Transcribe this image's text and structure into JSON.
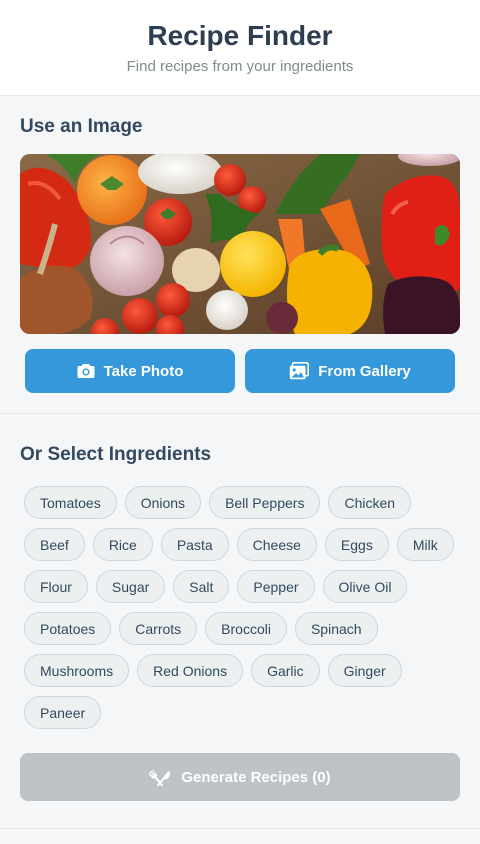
{
  "header": {
    "title": "Recipe Finder",
    "subtitle": "Find recipes from your ingredients"
  },
  "image_section": {
    "title": "Use an Image",
    "image_icon": "vegetables-photo",
    "take_photo_label": "Take Photo",
    "take_photo_icon": "camera-icon",
    "gallery_label": "From Gallery",
    "gallery_icon": "gallery-icon"
  },
  "ingredients_section": {
    "title": "Or Select Ingredients",
    "items": [
      "Tomatoes",
      "Onions",
      "Bell Peppers",
      "Chicken",
      "Beef",
      "Rice",
      "Pasta",
      "Cheese",
      "Eggs",
      "Milk",
      "Flour",
      "Sugar",
      "Salt",
      "Pepper",
      "Olive Oil",
      "Potatoes",
      "Carrots",
      "Broccoli",
      "Spinach",
      "Mushrooms",
      "Red Onions",
      "Garlic",
      "Ginger",
      "Paneer"
    ]
  },
  "generate": {
    "label": "Generate Recipes (0)",
    "icon": "utensils-icon",
    "enabled": false
  },
  "colors": {
    "primary": "#3498db",
    "disabled": "#bdc3c7",
    "text": "#2c3e50"
  }
}
